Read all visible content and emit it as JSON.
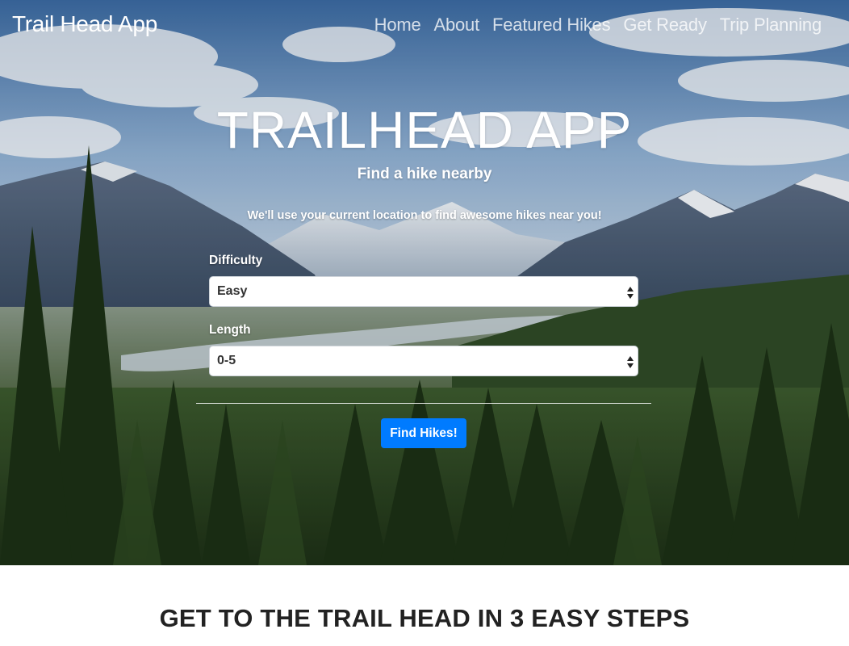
{
  "navbar": {
    "brand": "Trail Head App",
    "links": [
      "Home",
      "About",
      "Featured Hikes",
      "Get Ready",
      "Trip Planning"
    ]
  },
  "hero": {
    "title": "TRAILHEAD APP",
    "subtitle": "Find a hike nearby",
    "note": "We'll use your current location to find awesome hikes near you!",
    "background_image": "mountain-valley-forest-photo"
  },
  "form": {
    "difficulty": {
      "label": "Difficulty",
      "selected": "Easy"
    },
    "length": {
      "label": "Length",
      "selected": "0-5"
    },
    "submit_label": "Find Hikes!"
  },
  "steps": {
    "heading": "GET TO THE TRAIL HEAD IN 3 EASY STEPS"
  },
  "colors": {
    "primary_button": "#007bff",
    "hero_text": "#ffffff",
    "heading_text": "#222222"
  }
}
